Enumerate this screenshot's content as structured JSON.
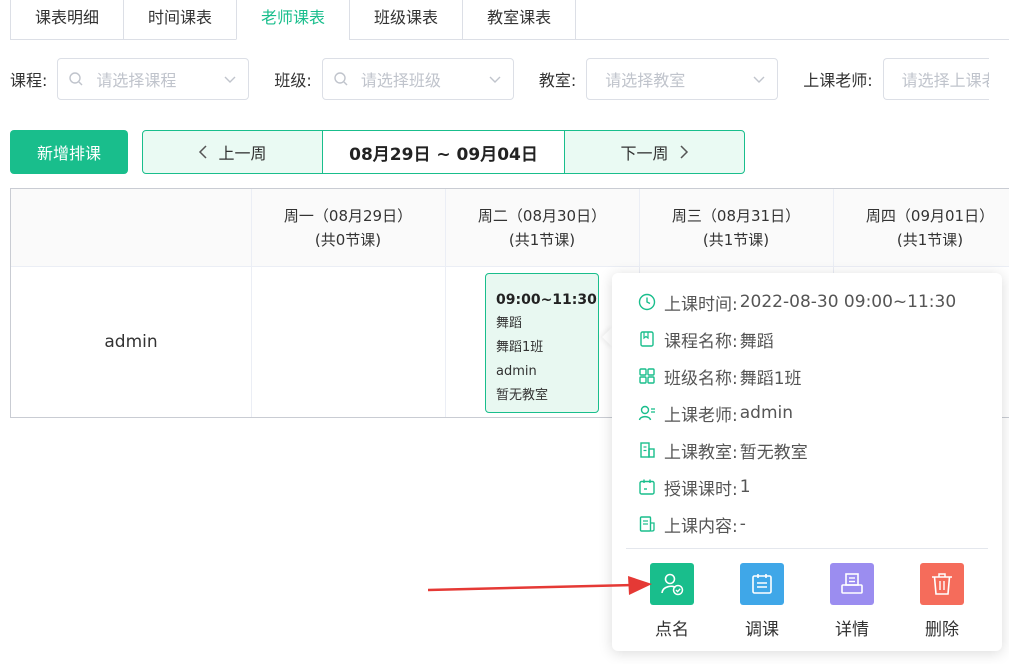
{
  "tabs": [
    "课表明细",
    "时间课表",
    "老师课表",
    "班级课表",
    "教室课表"
  ],
  "active_tab": "老师课表",
  "filters": {
    "course_label": "课程:",
    "course_placeholder": "请选择课程",
    "class_label": "班级:",
    "class_placeholder": "请选择班级",
    "room_label": "教室:",
    "room_placeholder": "请选择教室",
    "teacher_label": "上课老师:",
    "teacher_placeholder": "请选择上课老"
  },
  "toolbar": {
    "add_label": "新增排课",
    "prev_label": "上一周",
    "range": "08月29日 ~ 09月04日",
    "next_label": "下一周"
  },
  "grid": {
    "days": [
      {
        "label": "周一（08月29日）",
        "count": "(共0节课)"
      },
      {
        "label": "周二（08月30日）",
        "count": "(共1节课)"
      },
      {
        "label": "周三（08月31日）",
        "count": "(共1节课)"
      },
      {
        "label": "周四（09月01日）",
        "count": "(共1节课)"
      }
    ],
    "teacher": "admin",
    "lesson": {
      "time": "09:00~11:30",
      "course": "舞蹈",
      "class": "舞蹈1班",
      "teacher": "admin",
      "room": "暂无教室"
    }
  },
  "popover": {
    "rows": [
      {
        "icon": "clock-icon",
        "label": "上课时间:",
        "value": "2022-08-30 09:00~11:30"
      },
      {
        "icon": "book-icon",
        "label": "课程名称:",
        "value": "舞蹈"
      },
      {
        "icon": "grid-icon",
        "label": "班级名称:",
        "value": "舞蹈1班"
      },
      {
        "icon": "teacher-icon",
        "label": "上课老师:",
        "value": "admin"
      },
      {
        "icon": "building-icon",
        "label": "上课教室:",
        "value": "暂无教室"
      },
      {
        "icon": "calendar-icon",
        "label": "授课课时:",
        "value": "1"
      },
      {
        "icon": "document-icon",
        "label": "上课内容:",
        "value": "-"
      }
    ],
    "actions": [
      {
        "label": "点名",
        "color": "#19be8c",
        "icon": "roll-call-icon"
      },
      {
        "label": "调课",
        "color": "#3fa7e8",
        "icon": "reschedule-icon"
      },
      {
        "label": "详情",
        "color": "#9b8df0",
        "icon": "detail-icon"
      },
      {
        "label": "删除",
        "color": "#f56c5b",
        "icon": "trash-icon"
      }
    ]
  },
  "colors": {
    "accent": "#19be8c",
    "arrow": "#e53935"
  }
}
